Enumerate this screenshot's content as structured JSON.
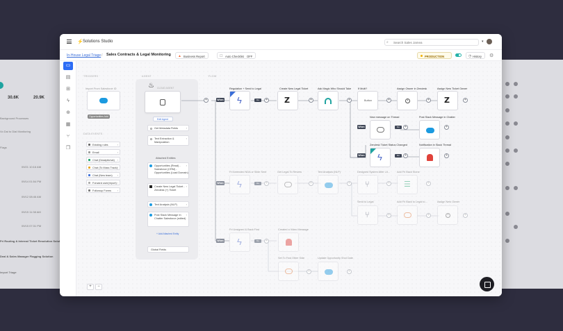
{
  "app": {
    "title": "Solutions Studio"
  },
  "search": {
    "placeholder": "Search Sales Jamea"
  },
  "breadcrumb": {
    "parent": "In-House Legal Triage",
    "current": "Sales Contracts & Legal Monitoring"
  },
  "toolbar": {
    "chip1": "Business Report",
    "chip2": "Auto Checklist",
    "chip2_state": "OFF",
    "environment": "PRODUCTION",
    "history_label": "History"
  },
  "background": {
    "stat1": "30.6K",
    "stat2": "20.9K",
    "items": [
      "Background Processes",
      "Vo Dai to Dial Monitoring",
      "Flags",
      "Inbound Processes",
      "Fri Routing & Internal Ticket Resolution Solutions",
      "Deal & Sales Manager Flagging Solution",
      "Import Triage"
    ],
    "dates": [
      "09/21 10:16 AM",
      "09/14 01:54 PM",
      "09/12 08:46 AM",
      "09/15 11:38 AM",
      "09/15 07:31 PM"
    ]
  },
  "canvas": {
    "labels": {
      "triggers": "TRIGGERS",
      "events": "DATA EVENTS",
      "agent": "AGENT",
      "flow": "FLOW"
    },
    "trigger": {
      "title": "Import From Salesforce ID",
      "tag": "Opportunities Add"
    },
    "events": [
      "Existing rules",
      "Email",
      "Chat (Deadpitchat)",
      "Chat (To Mass Track)",
      "Chat (New team)",
      "Forward user(report)",
      "Followup Forms"
    ],
    "agent": {
      "label": "CLOUD AGENT",
      "edit": "Edit Agent",
      "tools": [
        "Get Metadata Fields",
        "Text Extraction & Manipulation"
      ],
      "subtitle": "Attached Entities",
      "entities": [
        "Opportunities (Read) - Salesforce (CRM) - Opportunities (Load Domain)",
        "Create New Legal Ticket - Zendesk (+) Ticket",
        "Text Analysis (NLP)",
        "Post Slack Message In Chatter Salesforce (edited)"
      ],
      "add": "+ Add Attached Entity",
      "global": "Global Fields"
    },
    "flow": {
      "when": "When",
      "pill": "Do",
      "row1": [
        "Regulation + Send to Legal",
        "Create New Legal Ticket",
        "Ask Magic Who Should Take",
        "If Multi?",
        "Assign Owner in Zendesk",
        "Assign New Ticket Owner"
      ],
      "button_label": "Button",
      "branch1": [
        "New message on Thread",
        "Post Slack Message in Chatter"
      ],
      "branch2": [
        "Zendesk Ticket Status Changed",
        "Notification in Slack Thread"
      ],
      "row2": [
        "Fri Amended NDA or Slide Sent",
        "Get Legal To Review",
        "Text Analysis (NLP)",
        "Designed System After Lit...",
        "Add Fri Back Stone"
      ],
      "row2b": [
        "Send to Legal",
        "Add Fri Back to Legal to...",
        "Assign New Owner"
      ],
      "row3": [
        "Fri Unsigned & Back First",
        "Created a Video Message"
      ],
      "row3b": [
        "Set To Fwd Other Side",
        "Update Opportunity Shot Date"
      ]
    },
    "zoom": [
      "+",
      "−"
    ]
  },
  "colors": {
    "accent": "#2c6cf5",
    "teal": "#1fa3a0",
    "salesforce": "#1b9ae0",
    "alert": "#e0423a",
    "production": "#f2b100"
  }
}
